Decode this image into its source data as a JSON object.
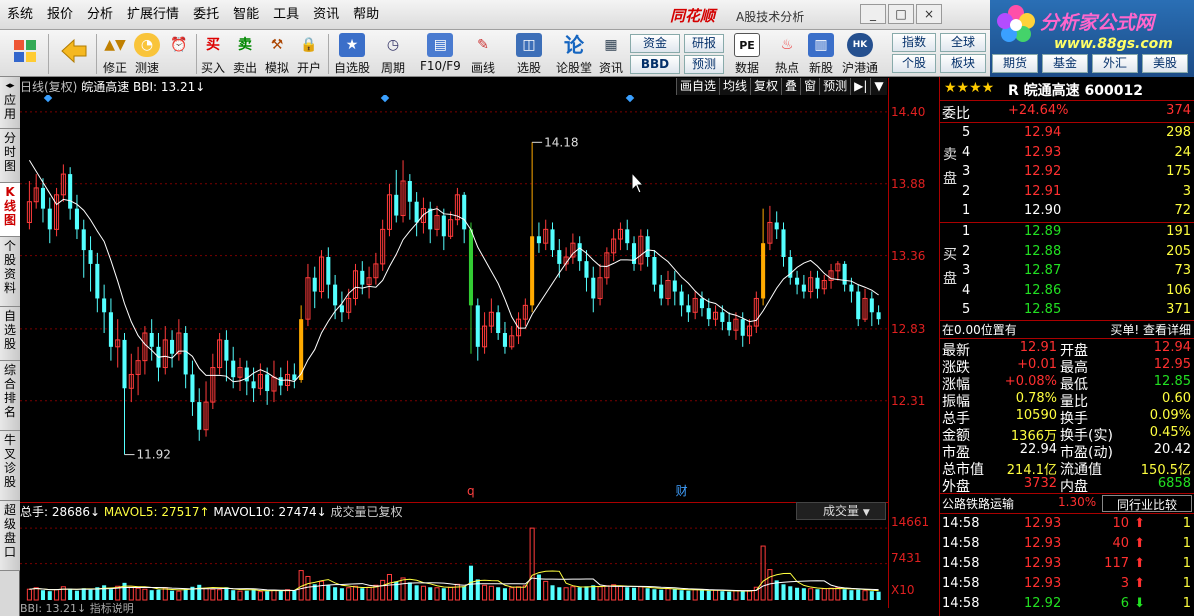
{
  "menu": [
    "系统",
    "报价",
    "分析",
    "扩展行情",
    "委托",
    "智能",
    "工具",
    "资讯",
    "帮助"
  ],
  "brand": "同花顺",
  "brand_sub": "A股技术分析",
  "logo": {
    "title": "分析家公式网",
    "url": "www.88gs.com"
  },
  "toolbar": {
    "buttons": [
      {
        "icon": "back-arrow-icon",
        "label": ""
      },
      {
        "icon": "modify-icon",
        "label": "修正"
      },
      {
        "icon": "speed-test-icon",
        "label": "测速"
      },
      {
        "icon": "buy-icon",
        "glyph": "买",
        "label": "买入"
      },
      {
        "icon": "sell-icon",
        "glyph": "卖",
        "label": "卖出"
      },
      {
        "icon": "simulate-icon",
        "label": "模拟"
      },
      {
        "icon": "open-account-icon",
        "label": "开户"
      },
      {
        "icon": "watchlist-icon",
        "label": "自选股"
      },
      {
        "icon": "period-icon",
        "label": "周期"
      },
      {
        "icon": "f10-icon",
        "label": "F10/F9"
      },
      {
        "icon": "draw-line-icon",
        "label": "画线"
      },
      {
        "icon": "stock-pick-icon",
        "label": "选股"
      },
      {
        "icon": "forum-icon",
        "glyph": "论",
        "label": "论股堂"
      },
      {
        "icon": "news-icon",
        "label": "资讯"
      },
      {
        "icon": "data-icon",
        "glyph": "PE",
        "label": "数据"
      },
      {
        "icon": "hot-icon",
        "label": "热点"
      },
      {
        "icon": "new-stock-icon",
        "label": "新股"
      },
      {
        "icon": "hk-connect-icon",
        "label": "沪港通"
      }
    ],
    "small": [
      "资金",
      "研报",
      "BBD",
      "预测"
    ],
    "right": [
      "指数",
      "全球",
      "个股",
      "板块"
    ],
    "right2": [
      "期货",
      "基金",
      "外汇",
      "美股"
    ]
  },
  "sidebar": [
    "应用",
    "分时图",
    "K线图",
    "个股资料",
    "自选股",
    "综合排名",
    "牛叉诊股",
    "超级盘口"
  ],
  "chart_header": {
    "period": "日线(复权)",
    "name": "皖通高速",
    "indicator": "BBI: 13.21↓"
  },
  "chart_tools": [
    "画自选",
    "均线",
    "复权",
    "叠",
    "窗",
    "预测",
    "▶|",
    "▼"
  ],
  "chart_data": {
    "type": "candlestick",
    "ylim": [
      11.7,
      14.45
    ],
    "y_ticks": [
      "14.40",
      "13.88",
      "13.36",
      "12.83",
      "12.31"
    ],
    "y_tick_values": [
      14.4,
      13.88,
      13.36,
      12.83,
      12.31
    ],
    "annotations": {
      "high": "14.18",
      "low": "11.92"
    },
    "markers": [
      "q",
      "财"
    ],
    "candles": [
      [
        13.6,
        13.75,
        13.9,
        13.55
      ],
      [
        13.75,
        13.85,
        13.95,
        13.7
      ],
      [
        13.85,
        13.7,
        13.92,
        13.6
      ],
      [
        13.7,
        13.55,
        13.78,
        13.45
      ],
      [
        13.55,
        13.8,
        13.85,
        13.5
      ],
      [
        13.8,
        13.95,
        14.02,
        13.75
      ],
      [
        13.95,
        13.7,
        14.0,
        13.62
      ],
      [
        13.7,
        13.55,
        13.8,
        13.48
      ],
      [
        13.55,
        13.4,
        13.62,
        13.2
      ],
      [
        13.4,
        13.3,
        13.5,
        13.1
      ],
      [
        13.3,
        13.05,
        13.38,
        12.95
      ],
      [
        13.05,
        12.95,
        13.15,
        12.8
      ],
      [
        12.95,
        12.7,
        13.05,
        12.6
      ],
      [
        12.7,
        12.75,
        12.9,
        12.55
      ],
      [
        12.75,
        12.4,
        12.8,
        11.92
      ],
      [
        12.4,
        12.5,
        12.65,
        12.3
      ],
      [
        12.5,
        12.6,
        12.7,
        12.35
      ],
      [
        12.6,
        12.8,
        12.85,
        12.5
      ],
      [
        12.8,
        12.7,
        12.9,
        12.6
      ],
      [
        12.7,
        12.55,
        12.8,
        12.45
      ],
      [
        12.55,
        12.75,
        12.85,
        12.5
      ],
      [
        12.75,
        12.65,
        12.82,
        12.55
      ],
      [
        12.65,
        12.8,
        12.9,
        12.6
      ],
      [
        12.8,
        12.5,
        12.85,
        12.4
      ],
      [
        12.5,
        12.3,
        12.6,
        12.2
      ],
      [
        12.3,
        12.1,
        12.4,
        12.02
      ],
      [
        12.1,
        12.3,
        12.45,
        12.05
      ],
      [
        12.3,
        12.55,
        12.65,
        12.25
      ],
      [
        12.55,
        12.75,
        12.8,
        12.5
      ],
      [
        12.75,
        12.6,
        12.82,
        12.45
      ],
      [
        12.6,
        12.48,
        12.7,
        12.4
      ],
      [
        12.48,
        12.55,
        12.62,
        12.38
      ],
      [
        12.55,
        12.45,
        12.6,
        12.35
      ],
      [
        12.45,
        12.4,
        12.55,
        12.3
      ],
      [
        12.4,
        12.5,
        12.58,
        12.35
      ],
      [
        12.5,
        12.38,
        12.55,
        12.28
      ],
      [
        12.38,
        12.48,
        12.6,
        12.3
      ],
      [
        12.48,
        12.42,
        12.55,
        12.35
      ],
      [
        12.42,
        12.5,
        12.6,
        12.38
      ],
      [
        12.5,
        12.46,
        12.58,
        12.4
      ],
      [
        12.46,
        12.9,
        13.0,
        12.44
      ],
      [
        12.9,
        13.2,
        13.3,
        12.85
      ],
      [
        13.2,
        13.1,
        13.28,
        12.98
      ],
      [
        13.1,
        13.35,
        13.4,
        13.05
      ],
      [
        13.35,
        13.15,
        13.42,
        13.05
      ],
      [
        13.15,
        13.0,
        13.22,
        12.9
      ],
      [
        13.0,
        12.95,
        13.1,
        12.88
      ],
      [
        12.95,
        13.05,
        13.12,
        12.9
      ],
      [
        13.05,
        13.25,
        13.3,
        13.0
      ],
      [
        13.25,
        13.15,
        13.32,
        13.08
      ],
      [
        13.15,
        13.2,
        13.28,
        13.05
      ],
      [
        13.2,
        13.3,
        13.38,
        13.15
      ],
      [
        13.3,
        13.55,
        13.62,
        13.25
      ],
      [
        13.55,
        13.8,
        13.88,
        13.5
      ],
      [
        13.8,
        13.65,
        13.98,
        13.6
      ],
      [
        13.65,
        13.9,
        14.05,
        13.6
      ],
      [
        13.9,
        13.75,
        13.95,
        13.62
      ],
      [
        13.75,
        13.6,
        13.82,
        13.5
      ],
      [
        13.6,
        13.7,
        13.78,
        13.52
      ],
      [
        13.7,
        13.55,
        13.75,
        13.45
      ],
      [
        13.55,
        13.65,
        13.72,
        13.5
      ],
      [
        13.65,
        13.5,
        13.7,
        13.4
      ],
      [
        13.5,
        13.62,
        13.68,
        13.48
      ],
      [
        13.62,
        13.8,
        13.85,
        13.58
      ],
      [
        13.8,
        13.55,
        13.82,
        13.45
      ],
      [
        13.55,
        13.0,
        13.6,
        12.65
      ],
      [
        13.0,
        12.7,
        13.05,
        12.6
      ],
      [
        12.7,
        12.85,
        12.95,
        12.65
      ],
      [
        12.85,
        12.95,
        13.05,
        12.8
      ],
      [
        12.95,
        12.8,
        13.0,
        12.75
      ],
      [
        12.8,
        12.7,
        12.88,
        12.65
      ],
      [
        12.7,
        12.78,
        12.85,
        12.68
      ],
      [
        12.78,
        12.9,
        12.95,
        12.72
      ],
      [
        12.9,
        13.0,
        13.05,
        12.85
      ],
      [
        13.0,
        13.5,
        14.18,
        12.95
      ],
      [
        13.5,
        13.45,
        13.6,
        13.38
      ],
      [
        13.45,
        13.55,
        13.62,
        13.4
      ],
      [
        13.55,
        13.4,
        13.6,
        13.35
      ],
      [
        13.4,
        13.3,
        13.48,
        13.2
      ],
      [
        13.3,
        13.35,
        13.42,
        13.25
      ],
      [
        13.35,
        13.45,
        13.52,
        13.3
      ],
      [
        13.45,
        13.32,
        13.5,
        13.25
      ],
      [
        13.32,
        13.2,
        13.4,
        13.1
      ],
      [
        13.2,
        13.05,
        13.28,
        12.95
      ],
      [
        13.05,
        13.2,
        13.3,
        13.0
      ],
      [
        13.2,
        13.38,
        13.42,
        13.15
      ],
      [
        13.38,
        13.48,
        13.55,
        13.32
      ],
      [
        13.48,
        13.55,
        13.6,
        13.4
      ],
      [
        13.55,
        13.45,
        13.62,
        13.4
      ],
      [
        13.45,
        13.3,
        13.5,
        13.25
      ],
      [
        13.3,
        13.5,
        13.55,
        13.25
      ],
      [
        13.5,
        13.35,
        13.55,
        13.28
      ],
      [
        13.35,
        13.15,
        13.4,
        13.1
      ],
      [
        13.15,
        13.05,
        13.22,
        13.0
      ],
      [
        13.05,
        13.18,
        13.25,
        13.0
      ],
      [
        13.18,
        13.1,
        13.25,
        13.0
      ],
      [
        13.1,
        13.0,
        13.15,
        12.92
      ],
      [
        13.0,
        12.95,
        13.08,
        12.88
      ],
      [
        12.95,
        13.05,
        13.1,
        12.9
      ],
      [
        13.05,
        12.98,
        13.1,
        12.92
      ],
      [
        12.98,
        12.9,
        13.05,
        12.85
      ],
      [
        12.9,
        12.95,
        13.0,
        12.85
      ],
      [
        12.95,
        12.88,
        13.0,
        12.82
      ],
      [
        12.88,
        12.82,
        12.95,
        12.78
      ],
      [
        12.82,
        12.9,
        12.95,
        12.75
      ],
      [
        12.9,
        12.78,
        12.95,
        12.7
      ],
      [
        12.78,
        12.85,
        12.9,
        12.72
      ],
      [
        12.85,
        13.05,
        13.1,
        12.8
      ],
      [
        13.05,
        13.45,
        13.7,
        13.0
      ],
      [
        13.45,
        13.6,
        13.72,
        13.4
      ],
      [
        13.6,
        13.55,
        13.68,
        13.48
      ],
      [
        13.55,
        13.35,
        13.6,
        13.28
      ],
      [
        13.35,
        13.2,
        13.4,
        13.15
      ],
      [
        13.2,
        13.15,
        13.25,
        13.08
      ],
      [
        13.15,
        13.1,
        13.22,
        13.05
      ],
      [
        13.1,
        13.2,
        13.25,
        13.05
      ],
      [
        13.2,
        13.12,
        13.25,
        13.05
      ],
      [
        13.12,
        13.18,
        13.22,
        13.08
      ],
      [
        13.18,
        13.25,
        13.3,
        13.12
      ],
      [
        13.25,
        13.3,
        13.32,
        13.18
      ],
      [
        13.3,
        13.15,
        13.32,
        13.1
      ],
      [
        13.15,
        13.1,
        13.2,
        13.02
      ],
      [
        13.1,
        12.9,
        13.15,
        12.85
      ],
      [
        12.9,
        13.05,
        13.12,
        12.88
      ],
      [
        13.05,
        12.95,
        13.1,
        12.85
      ],
      [
        12.95,
        12.9,
        13.0,
        12.86
      ]
    ]
  },
  "volume": {
    "header": {
      "total": "总手: 28686↓",
      "mavol5": "MAVOL5: 27517↑",
      "mavol10": "MAVOL10: 27474↓",
      "note": "成交量已复权"
    },
    "selector": "成交量",
    "ticks": [
      "14661",
      "7431",
      "X10"
    ],
    "ylim": [
      0,
      15500
    ],
    "bars": [
      22000,
      25000,
      20000,
      18000,
      21000,
      27000,
      23000,
      19000,
      24000,
      21000,
      26000,
      30000,
      22000,
      28000,
      35000,
      26000,
      24000,
      22000,
      20000,
      21000,
      25000,
      19000,
      18000,
      23000,
      27000,
      31000,
      24000,
      22000,
      21000,
      26000,
      20000,
      18000,
      19000,
      22000,
      17000,
      18000,
      20000,
      19000,
      21000,
      19000,
      60000,
      48000,
      32000,
      38000,
      30000,
      26000,
      24000,
      25000,
      28000,
      24000,
      26000,
      30000,
      40000,
      52000,
      38000,
      45000,
      36000,
      30000,
      28000,
      26000,
      25000,
      24000,
      26000,
      32000,
      28000,
      70000,
      42000,
      30000,
      28000,
      26000,
      24000,
      25000,
      27000,
      29000,
      146610,
      52000,
      38000,
      30000,
      26000,
      25000,
      27000,
      26000,
      28000,
      30000,
      27000,
      29000,
      31000,
      28000,
      26000,
      25000,
      27000,
      24000,
      22000,
      21000,
      23000,
      22000,
      20000,
      19000,
      21000,
      20000,
      19000,
      20000,
      18000,
      17000,
      19000,
      18000,
      19000,
      26000,
      110000,
      62000,
      40000,
      32000,
      28000,
      25000,
      24000,
      23000,
      22000,
      23000,
      24000,
      25000,
      22000,
      20000,
      21000,
      19000,
      18000,
      17000
    ],
    "bottom": "BBI: 13.21↓   指标说明"
  },
  "stock": {
    "stars": "★★★★",
    "flag": "R",
    "name": "皖通高速",
    "code": "600012"
  },
  "orderbook": {
    "webi": {
      "label": "委比",
      "pct": "+24.64%",
      "diff": "374"
    },
    "sell_label": [
      "卖",
      "盘"
    ],
    "buy_label": [
      "买",
      "盘"
    ],
    "asks": [
      {
        "lvl": "5",
        "price": "12.94",
        "vol": "298"
      },
      {
        "lvl": "4",
        "price": "12.93",
        "vol": "24"
      },
      {
        "lvl": "3",
        "price": "12.92",
        "vol": "175"
      },
      {
        "lvl": "2",
        "price": "12.91",
        "vol": "3"
      },
      {
        "lvl": "1",
        "price": "12.90",
        "vol": "72"
      }
    ],
    "bids": [
      {
        "lvl": "1",
        "price": "12.89",
        "vol": "191"
      },
      {
        "lvl": "2",
        "price": "12.88",
        "vol": "205"
      },
      {
        "lvl": "3",
        "price": "12.87",
        "vol": "73"
      },
      {
        "lvl": "4",
        "price": "12.86",
        "vol": "106"
      },
      {
        "lvl": "5",
        "price": "12.85",
        "vol": "371"
      }
    ],
    "notice_left": "在0.00位置有",
    "notice_right": "买单! 查看详细"
  },
  "quote": [
    {
      "l1": "最新",
      "v1": "12.91",
      "c1": "red",
      "l2": "开盘",
      "v2": "12.94",
      "c2": "red"
    },
    {
      "l1": "涨跌",
      "v1": "+0.01",
      "c1": "red",
      "l2": "最高",
      "v2": "12.95",
      "c2": "red"
    },
    {
      "l1": "涨幅",
      "v1": "+0.08%",
      "c1": "red",
      "l2": "最低",
      "v2": "12.85",
      "c2": "grn"
    },
    {
      "l1": "振幅",
      "v1": "0.78%",
      "c1": "yel",
      "l2": "量比",
      "v2": "0.60",
      "c2": "yel"
    },
    {
      "l1": "总手",
      "v1": "10590",
      "c1": "yel",
      "l2": "换手",
      "v2": "0.09%",
      "c2": "yel"
    },
    {
      "l1": "金额",
      "v1": "1366万",
      "c1": "yel",
      "l2": "换手(实)",
      "v2": "0.45%",
      "c2": "yel"
    },
    {
      "l1": "市盈",
      "v1": "22.94",
      "c1": "wht",
      "l2": "市盈(动)",
      "v2": "20.42",
      "c2": "wht"
    },
    {
      "l1": "总市值",
      "v1": "214.1亿",
      "c1": "yel",
      "l2": "流通值",
      "v2": "150.5亿",
      "c2": "yel"
    },
    {
      "l1": "外盘",
      "v1": "3732",
      "c1": "red",
      "l2": "内盘",
      "v2": "6858",
      "c2": "grn"
    }
  ],
  "industry": {
    "name": "公路铁路运输",
    "pct": "1.30%",
    "button": "同行业比较"
  },
  "ticks": [
    {
      "time": "14:58",
      "price": "12.93",
      "vol": "10",
      "dir": "up",
      "n": "1"
    },
    {
      "time": "14:58",
      "price": "12.93",
      "vol": "40",
      "dir": "up",
      "n": "1"
    },
    {
      "time": "14:58",
      "price": "12.93",
      "vol": "117",
      "dir": "up",
      "n": "1"
    },
    {
      "time": "14:58",
      "price": "12.93",
      "vol": "3",
      "dir": "up",
      "n": "1"
    },
    {
      "time": "14:58",
      "price": "12.92",
      "vol": "6",
      "dir": "down",
      "n": "1"
    }
  ]
}
